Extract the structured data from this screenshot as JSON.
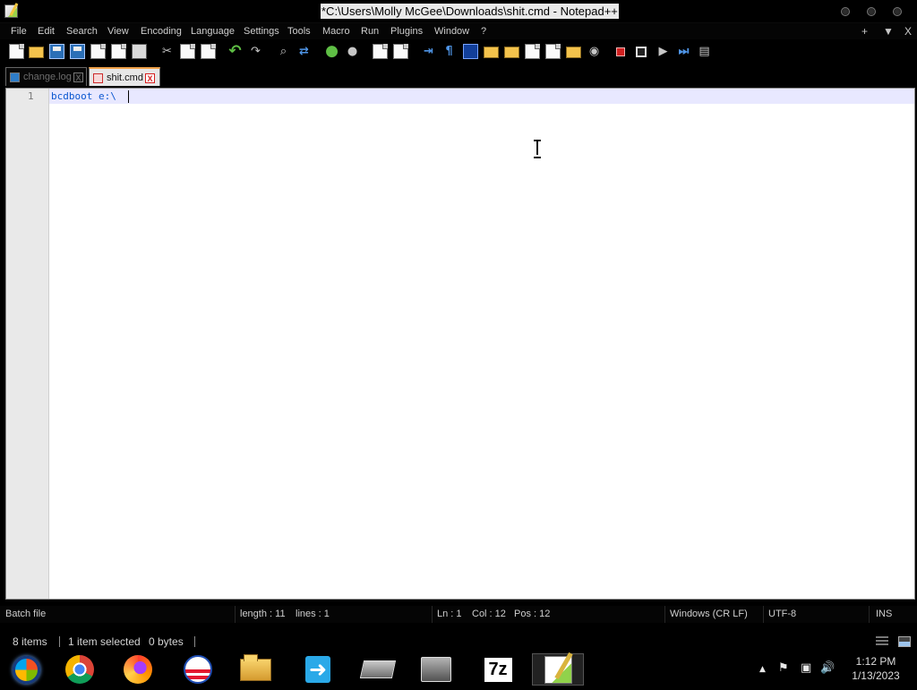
{
  "window": {
    "title": "*C:\\Users\\Molly McGee\\Downloads\\shit.cmd - Notepad++"
  },
  "menu": {
    "items": [
      "File",
      "Edit",
      "Search",
      "View",
      "Encoding",
      "Language",
      "Settings",
      "Tools",
      "Macro",
      "Run",
      "Plugins",
      "Window",
      "?"
    ],
    "right_controls": [
      "+",
      "▼",
      "X"
    ]
  },
  "toolbar": {
    "icons": [
      "new-file-icon",
      "open-file-icon",
      "save-icon",
      "save-all-icon",
      "close-icon",
      "close-all-icon",
      "print-icon",
      "cut-icon",
      "copy-icon",
      "paste-icon",
      "undo-icon",
      "redo-icon",
      "find-icon",
      "replace-icon",
      "zoom-in-icon",
      "zoom-out-icon",
      "sync-vertical-icon",
      "sync-horizontal-icon",
      "word-wrap-icon",
      "show-all-characters-icon",
      "indent-guide-icon",
      "document-map-icon",
      "function-list-icon",
      "folder-as-workspace-icon",
      "monitor-icon",
      "record-macro-icon",
      "stop-macro-icon",
      "play-macro-icon",
      "run-macro-multiple-icon",
      "save-macro-icon"
    ]
  },
  "tabs": [
    {
      "label": "change.log",
      "close": "X"
    },
    {
      "label": "shit.cmd",
      "close": "X"
    }
  ],
  "editor": {
    "line_number": "1",
    "line_text": "bcdboot e:\\"
  },
  "status": {
    "language": "Batch file",
    "length": "length : 11",
    "lines": "lines : 1",
    "ln": "Ln : 1",
    "col": "Col : 12",
    "pos": "Pos : 12",
    "eol": "Windows (CR LF)",
    "encoding": "UTF-8",
    "mode": "INS"
  },
  "explorer_status": {
    "items": "8 items",
    "selected": "1 item selected",
    "size": "0 bytes"
  },
  "taskbar": {
    "apps": [
      "start-orb-icon",
      "chrome-icon",
      "firefox-icon",
      "obama-campaign-icon",
      "file-explorer-icon",
      "sync-app-icon",
      "drive-icon",
      "device-icon",
      "7zip-icon",
      "notepad-plus-plus-icon"
    ],
    "seven_zip_label": "7z",
    "tray_up": "▲",
    "flag": "⚑",
    "network": "▣",
    "volume": "🔊",
    "time": "1:12 PM",
    "date": "1/13/2023"
  },
  "colors": {
    "editor_text": "#0b57d0",
    "current_line": "#e8e8ff",
    "active_tab_accent": "#f0a24a",
    "dark_background": "#000000"
  }
}
